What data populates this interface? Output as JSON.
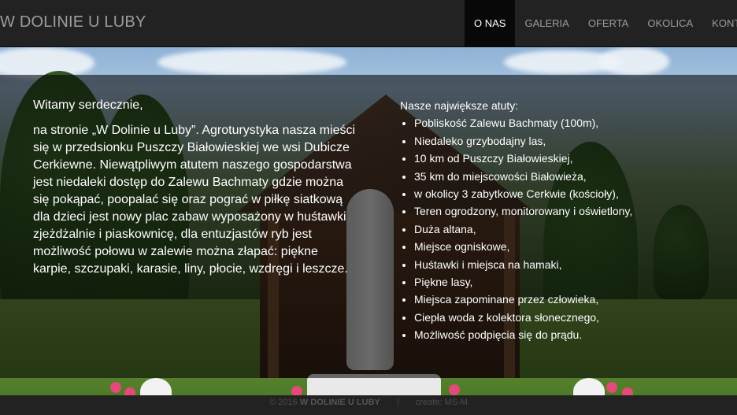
{
  "header": {
    "brand": "W DOLINIE U LUBY",
    "nav": [
      {
        "label": "O NAS",
        "active": true
      },
      {
        "label": "GALERIA",
        "active": false
      },
      {
        "label": "OFERTA",
        "active": false
      },
      {
        "label": "OKOLICA",
        "active": false
      },
      {
        "label": "KONTAKT",
        "active": false
      }
    ]
  },
  "main": {
    "welcome_heading": "Witamy serdecznie,",
    "welcome_text": "na stronie „W Dolinie u Luby”. Agroturystyka nasza mieści się w przedsionku Puszczy Białowieskiej we wsi Dubicze Cerkiewne. Niewątpliwym atutem naszego gospodarstwa jest niedaleki dostęp do Zalewu Bachmaty gdzie można się pokąpać, poopalać się oraz pograć w piłkę siatkową dla dzieci jest nowy plac zabaw wyposażony w huśtawki zjeżdżalnie i piaskownicę, dla entuzjastów ryb jest możliwość połowu w zalewie można złapać: piękne karpie, szczupaki, karasie, liny, płocie, wzdręgi i leszcze.",
    "assets_title": "Nasze największe atuty:",
    "assets": [
      "Pobliskość Zalewu Bachmaty (100m),",
      "Niedaleko grzybodajny las,",
      "10 km od Puszczy Białowieskiej,",
      "35 km do miejscowości Białowieża,",
      "w okolicy 3 zabytkowe Cerkwie (kościoły),",
      "Teren ogrodzony, monitorowany i oświetlony,",
      "Duża altana,",
      "Miejsce ogniskowe,",
      "Huśtawki i miejsca na hamaki,",
      "Piękne lasy,",
      "Miejsca zapominane przez człowieka,",
      "Ciepła woda z kolektora słonecznego,",
      "Możliwość podpięcia się do prądu."
    ]
  },
  "footer": {
    "copyright": "© 2016",
    "site": "W DOLINIE U LUBY",
    "separator": "|",
    "credit": "create: MS-M"
  },
  "colors": {
    "navbar": "#222222",
    "active_tab": "#080808",
    "nav_text": "#9d9d9d",
    "overlay": "rgba(0,0,0,0.56)"
  }
}
